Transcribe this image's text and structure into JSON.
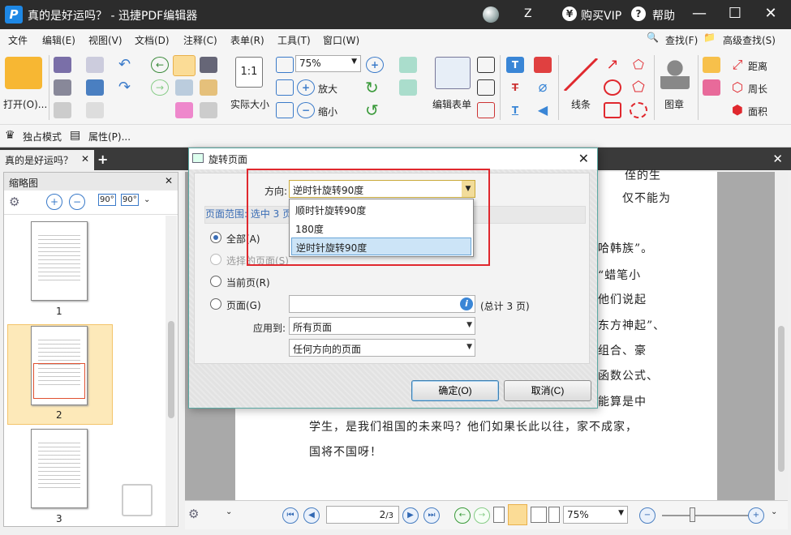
{
  "titlebar": {
    "title": "真的是好运吗？ - 迅捷PDF编辑器",
    "user": "Z",
    "vip_label": "购买VIP",
    "help_label": "帮助"
  },
  "menu": {
    "items": [
      "文件",
      "编辑(E)",
      "视图(V)",
      "文档(D)",
      "注释(C)",
      "表单(R)",
      "工具(T)",
      "窗口(W)"
    ],
    "find_label": "查找(F)",
    "advanced_find_label": "高级查找(S)"
  },
  "toolbar": {
    "open_label": "打开(O)...",
    "actual_size_label": "实际大小",
    "zoom_value": "75%",
    "zoom_in_label": "放大",
    "zoom_out_label": "缩小",
    "edit_form_label": "编辑表单",
    "lines_label": "线条",
    "stamp_label": "图章",
    "distance_label": "距离",
    "perimeter_label": "周长",
    "area_label": "面积"
  },
  "subbar": {
    "exclusive_mode_label": "独占模式",
    "properties_label": "属性(P)..."
  },
  "tabs": {
    "doc_tab_label": "真的是好运吗？"
  },
  "leftpanel": {
    "title": "缩略图",
    "page_numbers": [
      "1",
      "2",
      "3"
    ]
  },
  "document": {
    "lines": [
      "侄的生",
      "仅不能为",
      "哈韩族”。",
      "“蜡笔小",
      "他们说起",
      "东方神起”、",
      "组合、豪",
      "函数公式、",
      "能算是中",
      "学生，是我们祖国的未来吗？他们如果长此以往，家不成家，",
      "国将不国呀！"
    ]
  },
  "navbar": {
    "page_value": "2",
    "page_total": "/3",
    "zoom_value": "75%"
  },
  "dialog": {
    "title": "旋转页面",
    "direction_label": "方向:",
    "direction_value": "逆时针旋转90度",
    "page_range_label": "页面范围: 选中 3 页",
    "radio_all": "全部(A)",
    "radio_selected": "选择的页面(S)",
    "radio_current": "当前页(R)",
    "radio_pages": "页面(G)",
    "pages_value": "",
    "total_label": "(总计 3 页)",
    "apply_to_label": "应用到:",
    "apply_to_value": "所有页面",
    "orientation_value": "任何方向的页面",
    "ok_label": "确定(O)",
    "cancel_label": "取消(C)",
    "dropdown_options": [
      "顺时针旋转90度",
      "180度",
      "逆时针旋转90度"
    ],
    "selected_option_index": 2
  },
  "colors": {
    "titlebar_bg": "#2c2c2c",
    "highlight_red": "#e0282e",
    "accent_blue": "#3a86d6",
    "thumb_selected": "#fde9b9"
  }
}
